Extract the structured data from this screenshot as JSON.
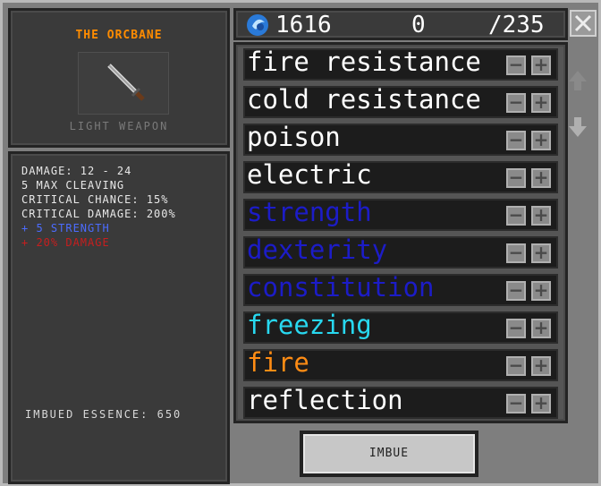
{
  "item": {
    "name": "THE ORCBANE",
    "type": "LIGHT WEAPON"
  },
  "stats": {
    "lines": [
      {
        "text": "DAMAGE: 12 - 24",
        "color": "#e8e8e8"
      },
      {
        "text": "5 MAX CLEAVING",
        "color": "#e8e8e8"
      },
      {
        "text": "CRITICAL CHANCE: 15%",
        "color": "#e8e8e8"
      },
      {
        "text": "CRITICAL DAMAGE: 200%",
        "color": "#e8e8e8"
      },
      {
        "text": "+ 5 STRENGTH",
        "color": "#4c6cff"
      },
      {
        "text": "+ 20% DAMAGE",
        "color": "#c81e1e"
      }
    ],
    "essence": "IMBUED ESSENCE: 650"
  },
  "resources": {
    "icon": "essence-gem-icon",
    "amount": "1616",
    "spent": "0",
    "max": "/235"
  },
  "enchantments": [
    {
      "label": "fire resistance",
      "color": "#ffffff"
    },
    {
      "label": "cold resistance",
      "color": "#ffffff"
    },
    {
      "label": "poison",
      "color": "#ffffff"
    },
    {
      "label": "electric",
      "color": "#ffffff"
    },
    {
      "label": "strength",
      "color": "#1c1cc8"
    },
    {
      "label": "dexterity",
      "color": "#1c1cc8"
    },
    {
      "label": "constitution",
      "color": "#1c1cc8"
    },
    {
      "label": "freezing",
      "color": "#28d8f0"
    },
    {
      "label": "fire",
      "color": "#ff8c14"
    },
    {
      "label": "reflection",
      "color": "#ffffff"
    }
  ],
  "buttons": {
    "minus": "−",
    "plus": "+",
    "imbue": "IMBUE"
  }
}
